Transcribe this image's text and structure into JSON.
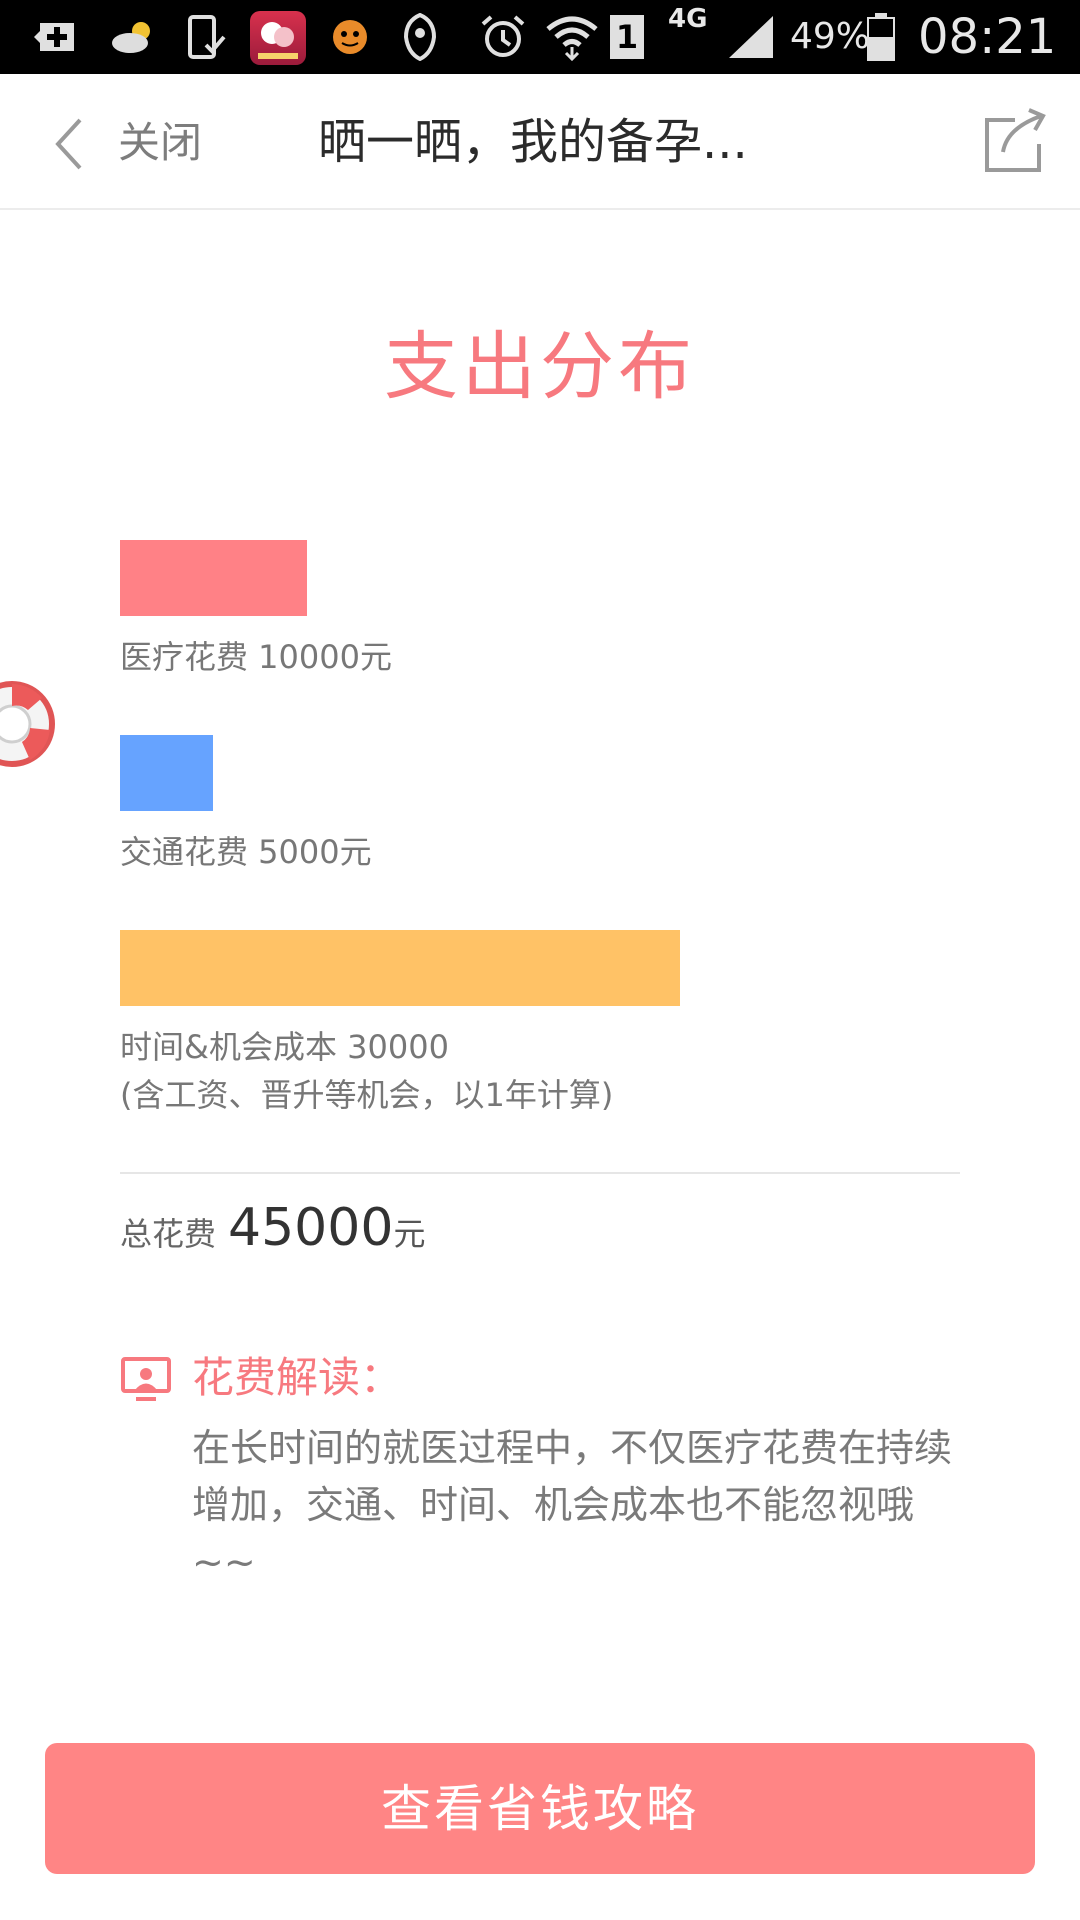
{
  "status_bar": {
    "icons": [
      "add-box-icon",
      "cloud-sun-icon",
      "phone-check-icon",
      "app-icon",
      "face-icon",
      "shield-icon",
      "alarm-icon",
      "wifi-icon",
      "sim-icon",
      "signal-icon",
      "battery-icon"
    ],
    "sim_number": "1",
    "network": "4G",
    "battery": "49%",
    "time": "08:21"
  },
  "navbar": {
    "close_label": "关闭",
    "title": "晒一晒，我的备孕...",
    "back_icon": "chevron-left-icon",
    "share_icon": "share-icon"
  },
  "page": {
    "title": "支出分布"
  },
  "chart_data": {
    "type": "bar",
    "categories": [
      "医疗花费",
      "交通花费",
      "时间&机会成本"
    ],
    "values": [
      10000,
      5000,
      30000
    ],
    "colors": [
      "#ff8186",
      "#66a3ff",
      "#ffc266"
    ],
    "labels": [
      "医疗花费 10000元",
      "交通花费 5000元",
      "时间&机会成本 30000"
    ],
    "note": "(含工资、晋升等机会，以1年计算)"
  },
  "total": {
    "label": "总花费",
    "value": "45000",
    "unit": "元"
  },
  "interpretation": {
    "title": "花费解读：",
    "text": "在长时间的就医过程中，不仅医疗花费在持续增加，交通、时间、机会成本也不能忽视哦~~",
    "icon": "monitor-user-icon"
  },
  "cta": {
    "label": "查看省钱攻略"
  },
  "floating": {
    "icon": "lifebuoy-icon"
  }
}
